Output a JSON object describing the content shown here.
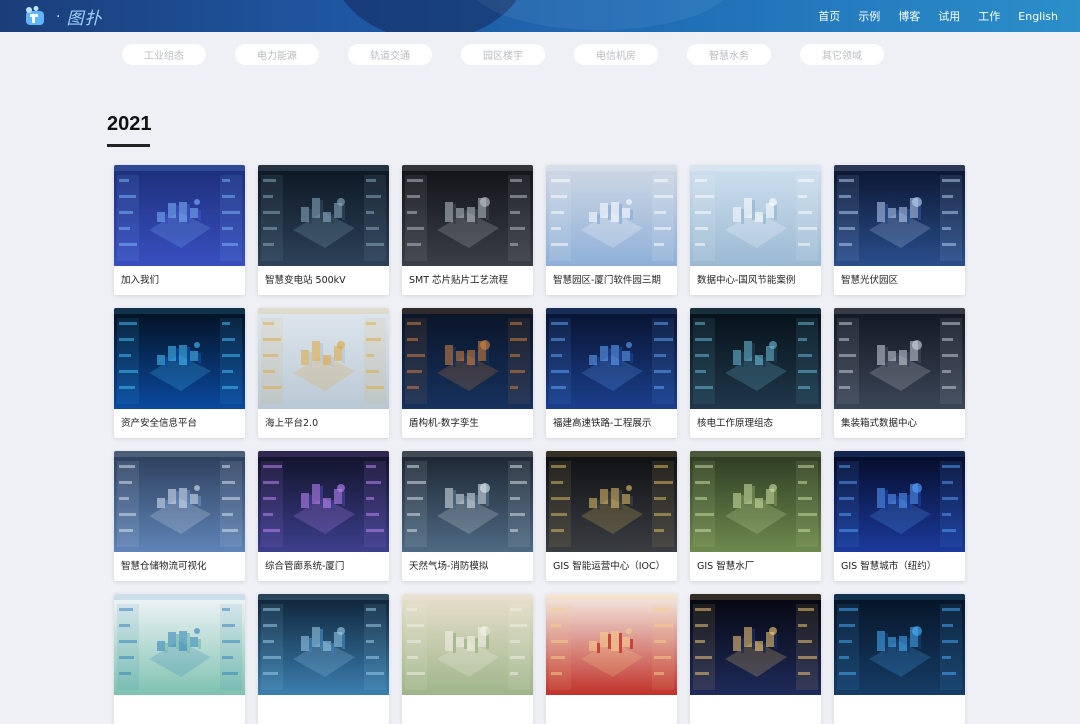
{
  "brand": {
    "name": "图扑"
  },
  "nav": {
    "items": [
      "首页",
      "示例",
      "博客",
      "试用",
      "工作",
      "English"
    ]
  },
  "categories": [
    "工业组态",
    "电力能源",
    "轨道交通",
    "园区楼宇",
    "电信机房",
    "智慧水务",
    "其它领域"
  ],
  "section": {
    "year": "2021"
  },
  "cards": [
    {
      "title": "加入我们",
      "theme": "join"
    },
    {
      "title": "智慧变电站 500kV",
      "theme": "substation"
    },
    {
      "title": "SMT 芯片贴片工艺流程",
      "theme": "smt"
    },
    {
      "title": "智慧园区-厦门软件园三期",
      "theme": "park"
    },
    {
      "title": "数据中心-国风节能案例",
      "theme": "datacenter"
    },
    {
      "title": "智慧光伏园区",
      "theme": "solar"
    },
    {
      "title": "资产安全信息平台",
      "theme": "security"
    },
    {
      "title": "海上平台2.0",
      "theme": "offshore"
    },
    {
      "title": "盾构机-数字孪生",
      "theme": "tbm"
    },
    {
      "title": "福建高速铁路-工程展示",
      "theme": "railway"
    },
    {
      "title": "核电工作原理组态",
      "theme": "nuclear"
    },
    {
      "title": "集装箱式数据中心",
      "theme": "container"
    },
    {
      "title": "智慧仓储物流可视化",
      "theme": "warehouse"
    },
    {
      "title": "综合管廊系统-厦门",
      "theme": "tunnel"
    },
    {
      "title": "天然气场-消防模拟",
      "theme": "gas"
    },
    {
      "title": "GIS 智能运营中心（IOC）",
      "theme": "gisioc"
    },
    {
      "title": "GIS 智慧水厂",
      "theme": "gisplant"
    },
    {
      "title": "GIS 智慧城市（纽约）",
      "theme": "giscity"
    },
    {
      "title": "",
      "theme": "dashboard-light"
    },
    {
      "title": "",
      "theme": "city-blue"
    },
    {
      "title": "",
      "theme": "dam"
    },
    {
      "title": "",
      "theme": "hall-red"
    },
    {
      "title": "",
      "theme": "space"
    },
    {
      "title": "",
      "theme": "map-dark"
    }
  ],
  "colors": {
    "header_start": "#1b3e7a",
    "header_end": "#2b8fc9",
    "page_bg": "#eef0f5"
  }
}
